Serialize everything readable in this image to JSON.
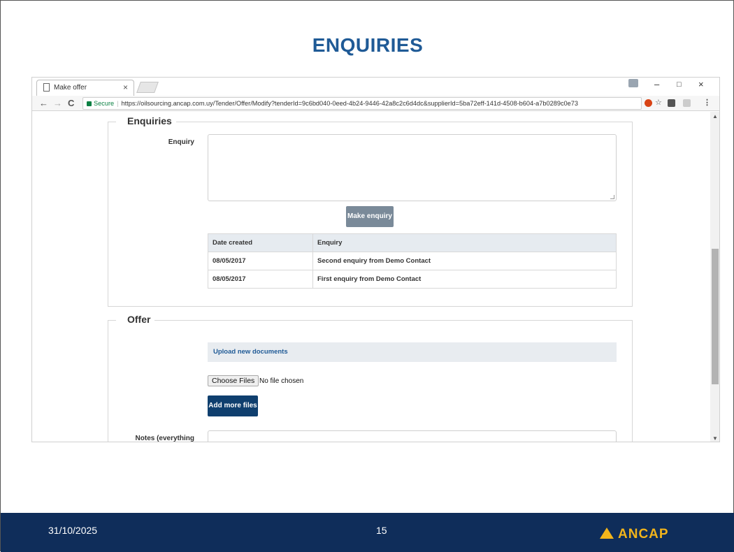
{
  "slide": {
    "title": "ENQUIRIES",
    "footer_date": "31/10/2025",
    "page_number": "15",
    "logo_text": "ANCAP"
  },
  "browser": {
    "tab_title": "Make offer",
    "tab_close": "×",
    "win_min": "–",
    "win_restore": "□",
    "win_close": "×",
    "back": "←",
    "forward": "→",
    "reload": "C",
    "secure_label": "Secure",
    "url": "https://oilsourcing.ancap.com.uy/Tender/Offer/Modify?tenderId=9c6bd040-0eed-4b24-9446-42a8c2c6d4dc&supplierId=5ba72eff-141d-4508-b604-a7b0289c0e73",
    "star": "☆",
    "menu": "⋮"
  },
  "enquiries_panel": {
    "legend": "Enquiries",
    "enquiry_label": "Enquiry",
    "enquiry_value": "",
    "make_enquiry_button": "Make enquiry",
    "table": {
      "headers": [
        "Date created",
        "Enquiry"
      ],
      "rows": [
        [
          "08/05/2017",
          "Second enquiry from Demo Contact"
        ],
        [
          "08/05/2017",
          "First enquiry from Demo Contact"
        ]
      ]
    }
  },
  "offer_panel": {
    "legend": "Offer",
    "upload_header": "Upload new documents",
    "choose_files_button": "Choose Files",
    "no_file_text": "No file chosen",
    "add_more_files_button": "Add more files",
    "notes_label": "Notes (everything written"
  },
  "colors": {
    "title": "#1f5a96",
    "footer_bg": "#0f2d5a",
    "logo": "#f2b41b",
    "make_enquiry_btn": "#7a8a99",
    "add_files_btn": "#0f3f6e"
  }
}
